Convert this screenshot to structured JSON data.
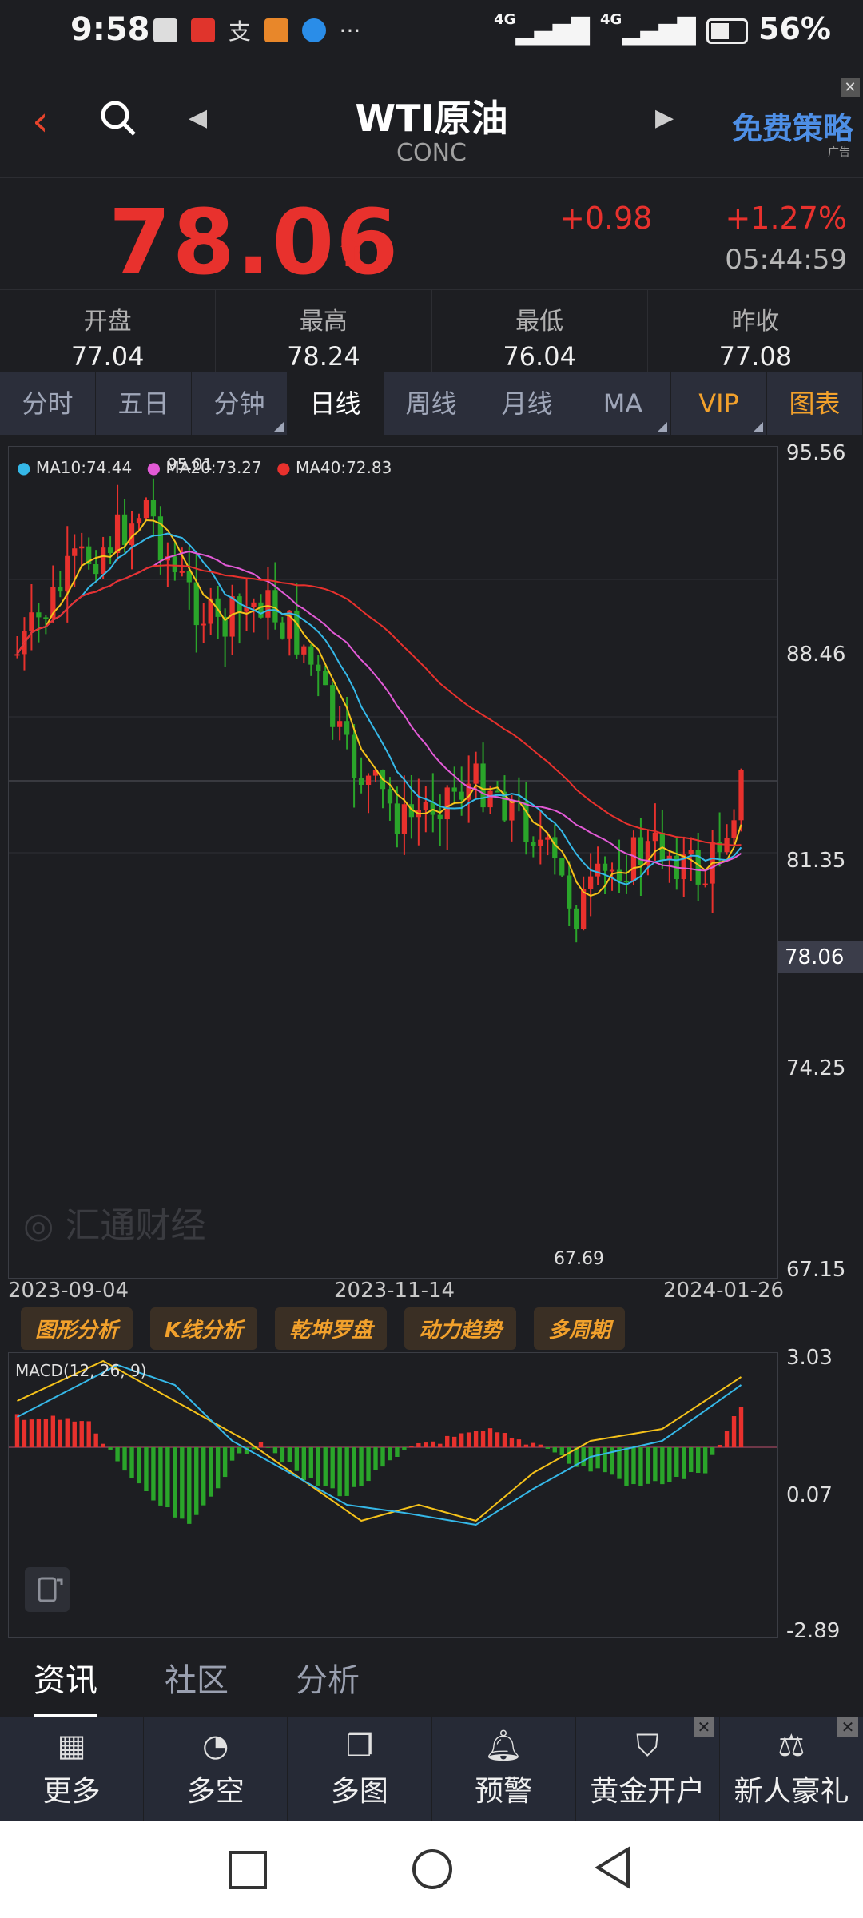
{
  "status": {
    "time": "9:58",
    "battery": "56%",
    "network1": "4G",
    "network2": "4G"
  },
  "header": {
    "title": "WTI原油",
    "subtitle": "CONC",
    "ad_label": "免费策略",
    "ad_tag": "广告"
  },
  "quote": {
    "price": "78.06",
    "change": "+0.98",
    "change_pct": "+1.27%",
    "time": "05:44:59"
  },
  "ohlc": [
    {
      "label": "开盘",
      "value": "77.04"
    },
    {
      "label": "最高",
      "value": "78.24"
    },
    {
      "label": "最低",
      "value": "76.04"
    },
    {
      "label": "昨收",
      "value": "77.08"
    }
  ],
  "tabs": [
    "分时",
    "五日",
    "分钟",
    "日线",
    "周线",
    "月线",
    "MA",
    "VIP",
    "图表"
  ],
  "legend": {
    "ma10": "MA10:74.44",
    "ma20": "MA20:73.27",
    "ma40": "MA40:72.83",
    "high_mark": "95.01",
    "low_mark": "67.69",
    "last_price": "78.06"
  },
  "yaxis": [
    "95.56",
    "88.46",
    "81.35",
    "74.25",
    "67.15"
  ],
  "xaxis": [
    "2023-09-04",
    "2023-11-14",
    "2024-01-26"
  ],
  "analysis_buttons": [
    "图形分析",
    "K线分析",
    "乾坤罗盘",
    "动力趋势",
    "多周期"
  ],
  "macd": {
    "label": "MACD(12, 26, 9)",
    "ymax": "3.03",
    "ymid": "0.07",
    "ymin": "-2.89"
  },
  "bottom_tabs": [
    "资讯",
    "社区",
    "分析"
  ],
  "toolbar": [
    {
      "label": "更多",
      "icon": "grid-icon"
    },
    {
      "label": "多空",
      "icon": "trend-icon"
    },
    {
      "label": "多图",
      "icon": "multi-chart-icon"
    },
    {
      "label": "预警",
      "icon": "bell-icon"
    },
    {
      "label": "黄金开户",
      "icon": "gold-icon"
    },
    {
      "label": "新人豪礼",
      "icon": "gift-icon"
    }
  ],
  "colors": {
    "up": "#e8312d",
    "down": "#2aa52a",
    "ma10": "#35b8e8",
    "ma20": "#e25ad6",
    "ma40": "#e8312d",
    "ma5": "#f5c21a"
  }
}
